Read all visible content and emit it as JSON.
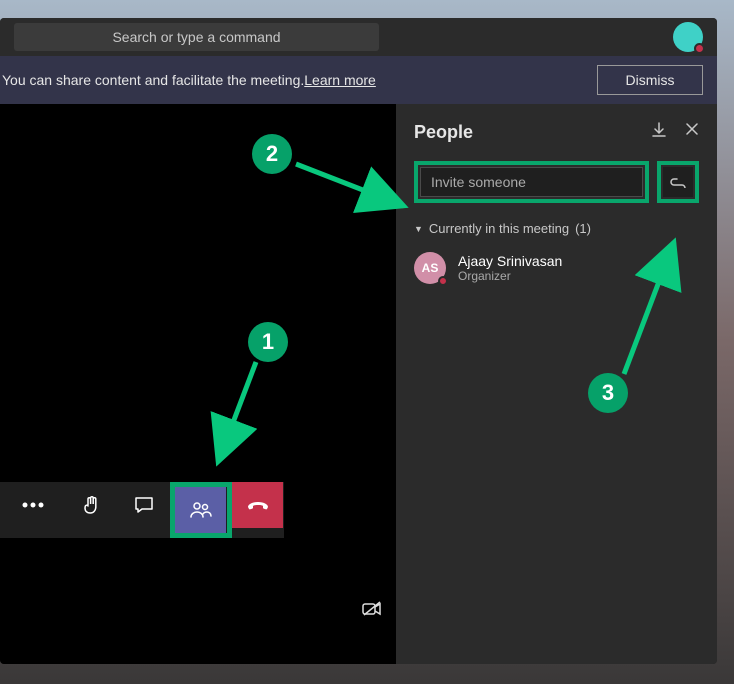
{
  "topbar": {
    "search_placeholder": "Search or type a command"
  },
  "banner": {
    "text": "You can share content and facilitate the meeting. ",
    "link": "Learn more",
    "dismiss": "Dismiss"
  },
  "panel": {
    "title": "People",
    "invite_placeholder": "Invite someone",
    "section_label": "Currently in this meeting",
    "section_count": "(1)"
  },
  "participant": {
    "initials": "AS",
    "name": "Ajaay Srinivasan",
    "role": "Organizer"
  },
  "annotations": {
    "n1": "1",
    "n2": "2",
    "n3": "3"
  }
}
